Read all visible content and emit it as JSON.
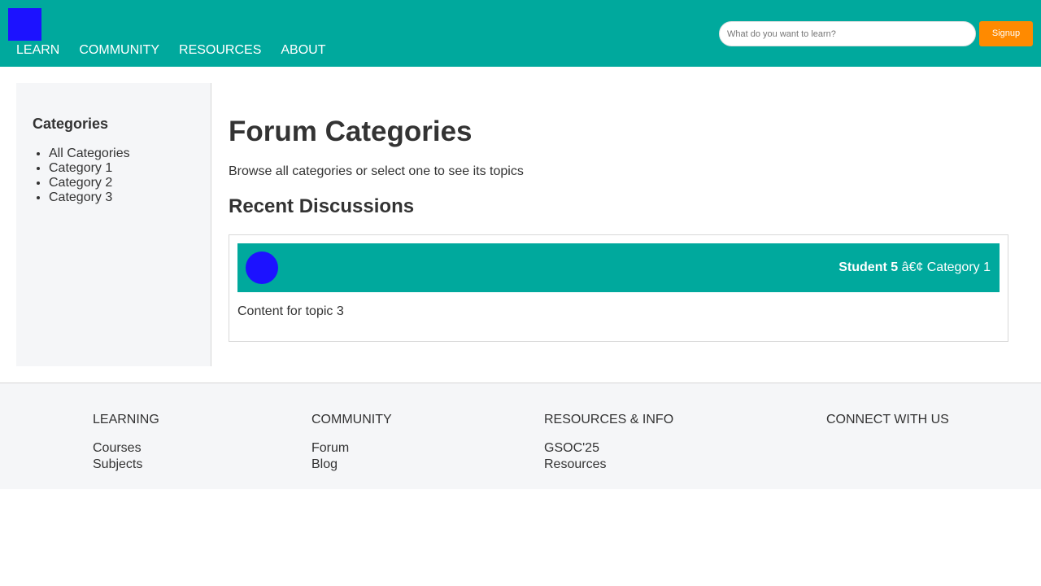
{
  "header": {
    "nav": [
      "LEARN",
      "COMMUNITY",
      "RESOURCES",
      "ABOUT"
    ],
    "search_placeholder": "What do you want to learn?",
    "signup_label": "Signup"
  },
  "sidebar": {
    "title": "Categories",
    "items": [
      "All Categories",
      "Category 1",
      "Category 2",
      "Category 3"
    ]
  },
  "main": {
    "title": "Forum Categories",
    "subtitle": "Browse all categories or select one to see its topics",
    "section_title": "Recent Discussions",
    "topic": {
      "author": "Student 5",
      "separator": " â€¢ ",
      "category": "Category 1",
      "content": "Content for topic 3"
    }
  },
  "footer": {
    "columns": [
      {
        "heading": "LEARNING",
        "links": [
          "Courses",
          "Subjects"
        ]
      },
      {
        "heading": "COMMUNITY",
        "links": [
          "Forum",
          "Blog"
        ]
      },
      {
        "heading": "RESOURCES & INFO",
        "links": [
          "GSOC'25",
          "Resources"
        ]
      },
      {
        "heading": "CONNECT WITH US",
        "links": []
      }
    ]
  },
  "colors": {
    "primary": "#00a99d",
    "accent": "#ff8a00",
    "placeholder_image": "#1c12ff",
    "panel_bg": "#f5f6f8"
  }
}
